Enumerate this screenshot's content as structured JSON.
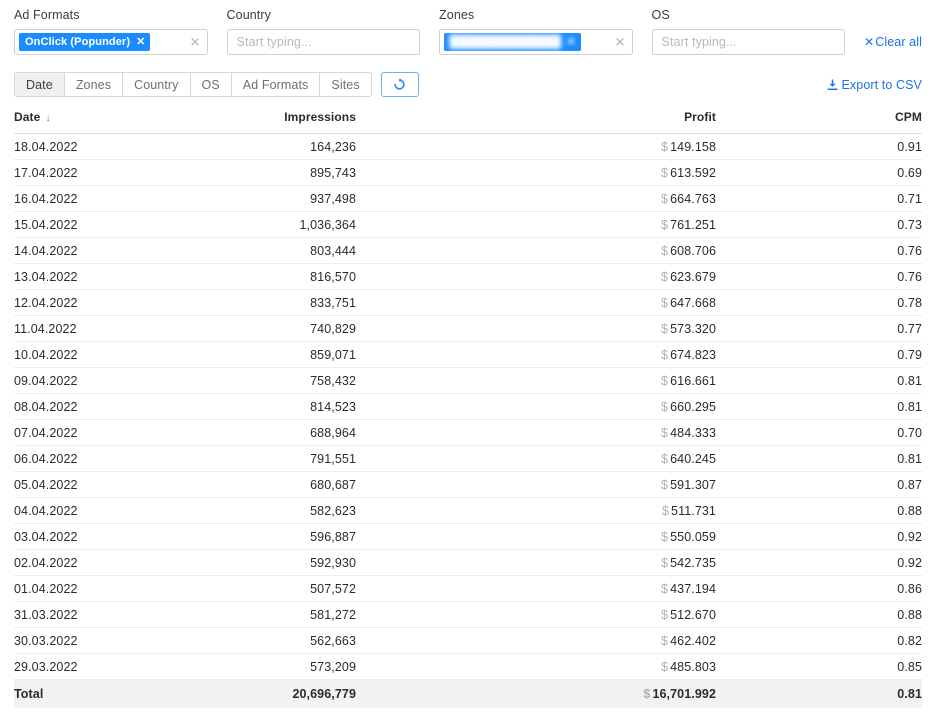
{
  "filters": [
    {
      "label": "Ad Formats",
      "name": "ad-formats",
      "chip": "OnClick (Popunder)",
      "chip_redacted": false,
      "placeholder": "",
      "clear_icon": "×"
    },
    {
      "label": "Country",
      "name": "country",
      "chip": "",
      "chip_redacted": false,
      "placeholder": "Start typing...",
      "clear_icon": ""
    },
    {
      "label": "Zones",
      "name": "zones",
      "chip": "██████████████",
      "chip_redacted": true,
      "placeholder": "",
      "clear_icon": "×"
    },
    {
      "label": "OS",
      "name": "os",
      "chip": "",
      "chip_redacted": false,
      "placeholder": "Start typing...",
      "clear_icon": ""
    }
  ],
  "clear_all": {
    "label": "Clear all",
    "icon": "×"
  },
  "toolbar": {
    "tabs": [
      {
        "label": "Date",
        "active": true
      },
      {
        "label": "Zones",
        "active": false
      },
      {
        "label": "Country",
        "active": false
      },
      {
        "label": "OS",
        "active": false
      },
      {
        "label": "Ad Formats",
        "active": false
      },
      {
        "label": "Sites",
        "active": false
      }
    ],
    "refresh_icon": "refresh-icon",
    "export_label": "Export to CSV",
    "export_icon": "download-icon",
    "accent_color": "#1a73e8"
  },
  "table": {
    "columns": [
      {
        "key": "date",
        "label": "Date",
        "align": "left",
        "sorted": true,
        "sort_dir": "desc",
        "sort_glyph": "↓"
      },
      {
        "key": "impressions",
        "label": "Impressions",
        "align": "right",
        "sorted": false
      },
      {
        "key": "profit",
        "label": "Profit",
        "align": "right",
        "sorted": false
      },
      {
        "key": "cpm",
        "label": "CPM",
        "align": "right",
        "sorted": false
      }
    ],
    "currency_symbol": "$",
    "rows": [
      {
        "date": "18.04.2022",
        "impressions": "164,236",
        "profit": "149.158",
        "cpm": "0.91"
      },
      {
        "date": "17.04.2022",
        "impressions": "895,743",
        "profit": "613.592",
        "cpm": "0.69"
      },
      {
        "date": "16.04.2022",
        "impressions": "937,498",
        "profit": "664.763",
        "cpm": "0.71"
      },
      {
        "date": "15.04.2022",
        "impressions": "1,036,364",
        "profit": "761.251",
        "cpm": "0.73"
      },
      {
        "date": "14.04.2022",
        "impressions": "803,444",
        "profit": "608.706",
        "cpm": "0.76"
      },
      {
        "date": "13.04.2022",
        "impressions": "816,570",
        "profit": "623.679",
        "cpm": "0.76"
      },
      {
        "date": "12.04.2022",
        "impressions": "833,751",
        "profit": "647.668",
        "cpm": "0.78"
      },
      {
        "date": "11.04.2022",
        "impressions": "740,829",
        "profit": "573.320",
        "cpm": "0.77"
      },
      {
        "date": "10.04.2022",
        "impressions": "859,071",
        "profit": "674.823",
        "cpm": "0.79"
      },
      {
        "date": "09.04.2022",
        "impressions": "758,432",
        "profit": "616.661",
        "cpm": "0.81"
      },
      {
        "date": "08.04.2022",
        "impressions": "814,523",
        "profit": "660.295",
        "cpm": "0.81"
      },
      {
        "date": "07.04.2022",
        "impressions": "688,964",
        "profit": "484.333",
        "cpm": "0.70"
      },
      {
        "date": "06.04.2022",
        "impressions": "791,551",
        "profit": "640.245",
        "cpm": "0.81"
      },
      {
        "date": "05.04.2022",
        "impressions": "680,687",
        "profit": "591.307",
        "cpm": "0.87"
      },
      {
        "date": "04.04.2022",
        "impressions": "582,623",
        "profit": "511.731",
        "cpm": "0.88"
      },
      {
        "date": "03.04.2022",
        "impressions": "596,887",
        "profit": "550.059",
        "cpm": "0.92"
      },
      {
        "date": "02.04.2022",
        "impressions": "592,930",
        "profit": "542.735",
        "cpm": "0.92"
      },
      {
        "date": "01.04.2022",
        "impressions": "507,572",
        "profit": "437.194",
        "cpm": "0.86"
      },
      {
        "date": "31.03.2022",
        "impressions": "581,272",
        "profit": "512.670",
        "cpm": "0.88"
      },
      {
        "date": "30.03.2022",
        "impressions": "562,663",
        "profit": "462.402",
        "cpm": "0.82"
      },
      {
        "date": "29.03.2022",
        "impressions": "573,209",
        "profit": "485.803",
        "cpm": "0.85"
      }
    ],
    "total": {
      "date": "Total",
      "impressions": "20,696,779",
      "profit": "16,701.992",
      "cpm": "0.81"
    }
  },
  "chart_data": {
    "type": "table",
    "title": "Date report — Impressions / Profit / CPM",
    "columns": [
      "Date",
      "Impressions",
      "Profit",
      "CPM"
    ],
    "x": [
      "18.04.2022",
      "17.04.2022",
      "16.04.2022",
      "15.04.2022",
      "14.04.2022",
      "13.04.2022",
      "12.04.2022",
      "11.04.2022",
      "10.04.2022",
      "09.04.2022",
      "08.04.2022",
      "07.04.2022",
      "06.04.2022",
      "05.04.2022",
      "04.04.2022",
      "03.04.2022",
      "02.04.2022",
      "01.04.2022",
      "31.03.2022",
      "30.03.2022",
      "29.03.2022"
    ],
    "series": [
      {
        "name": "Impressions",
        "values": [
          164236,
          895743,
          937498,
          1036364,
          803444,
          816570,
          833751,
          740829,
          859071,
          758432,
          814523,
          688964,
          791551,
          680687,
          582623,
          596887,
          592930,
          507572,
          581272,
          562663,
          573209
        ]
      },
      {
        "name": "Profit",
        "unit": "$",
        "values": [
          149.158,
          613.592,
          664.763,
          761.251,
          608.706,
          623.679,
          647.668,
          573.32,
          674.823,
          616.661,
          660.295,
          484.333,
          640.245,
          591.307,
          511.731,
          550.059,
          542.735,
          437.194,
          512.67,
          462.402,
          485.803
        ]
      },
      {
        "name": "CPM",
        "values": [
          0.91,
          0.69,
          0.71,
          0.73,
          0.76,
          0.76,
          0.78,
          0.77,
          0.79,
          0.81,
          0.81,
          0.7,
          0.81,
          0.87,
          0.88,
          0.92,
          0.92,
          0.86,
          0.88,
          0.82,
          0.85
        ]
      }
    ],
    "totals": {
      "Impressions": 20696779,
      "Profit": 16701.992,
      "CPM": 0.81
    },
    "xlabel": "Date",
    "ylabel": "",
    "grid": false,
    "legend": "none"
  }
}
